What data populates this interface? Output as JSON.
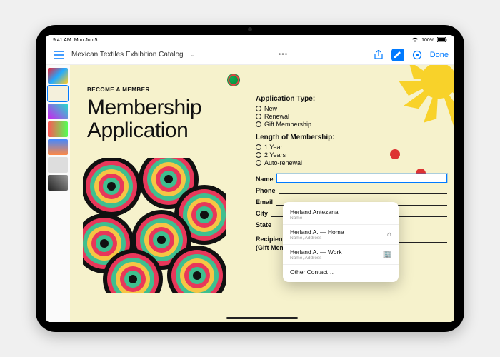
{
  "statusbar": {
    "time": "9:41 AM",
    "date": "Mon Jun 5",
    "wifi": "wifi-icon",
    "battery_pct": "100%"
  },
  "toolbar": {
    "doc_title": "Mexican Textiles Exhibition Catalog",
    "done_label": "Done"
  },
  "document": {
    "kicker": "BECOME A MEMBER",
    "headline_line1": "Membership",
    "headline_line2": "Application",
    "form": {
      "app_type_label": "Application Type:",
      "app_type_options": [
        "New",
        "Renewal",
        "Gift Membership"
      ],
      "length_label": "Length of Membership:",
      "length_options": [
        "1 Year",
        "2 Years",
        "Auto-renewal"
      ],
      "fields": {
        "name": "Name",
        "phone": "Phone",
        "email": "Email",
        "city": "City",
        "state": "State",
        "recipient": "Recipient's Name",
        "recipient_sub": "(Gift Membership)"
      }
    }
  },
  "autofill": {
    "items": [
      {
        "name": "Herland Antezana",
        "sub": "Name"
      },
      {
        "name": "Herland A. — Home",
        "sub": "Name, Address",
        "icon": "home-icon"
      },
      {
        "name": "Herland A. — Work",
        "sub": "Name, Address",
        "icon": "building-icon"
      }
    ],
    "other_label": "Other Contact…"
  }
}
